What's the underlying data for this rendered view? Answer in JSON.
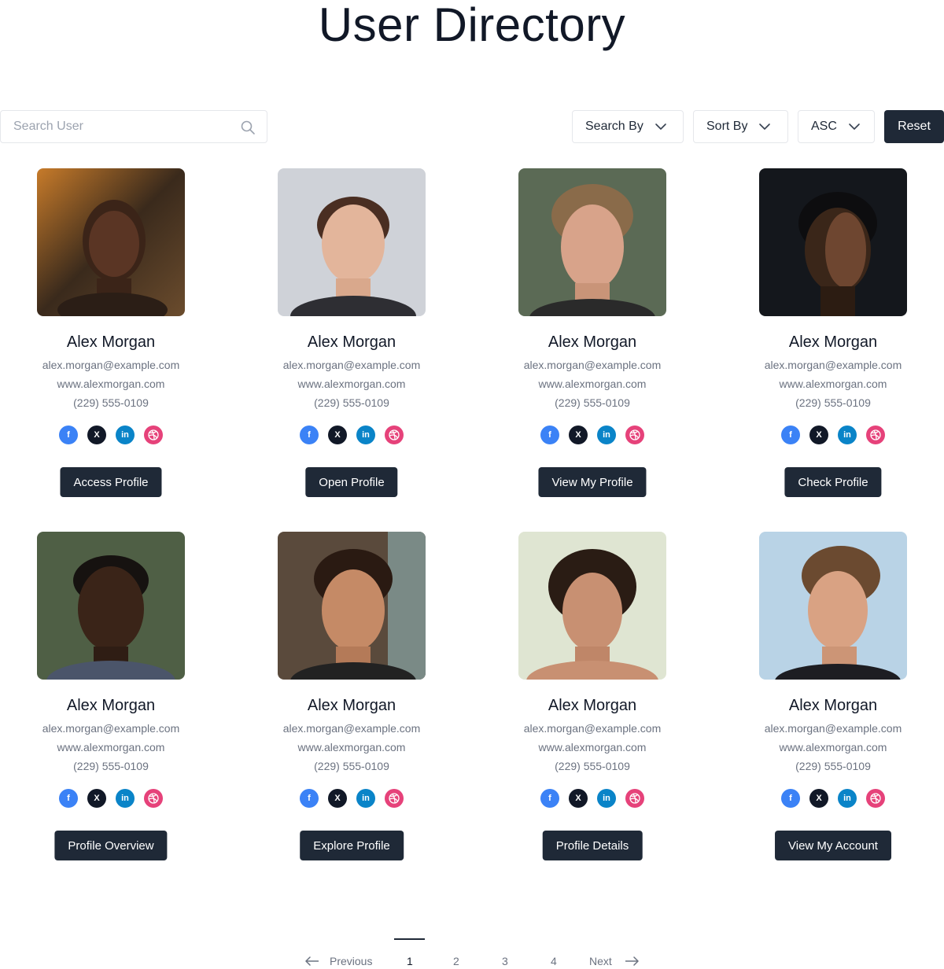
{
  "page": {
    "title": "User Directory"
  },
  "toolbar": {
    "search_placeholder": "Search User",
    "search_by_label": "Search By",
    "sort_by_label": "Sort By",
    "order_label": "ASC",
    "reset_label": "Reset"
  },
  "users": [
    {
      "name": "Alex Morgan",
      "email": "alex.morgan@example.com",
      "website": "www.alexmorgan.com",
      "phone": "(229) 555-0109",
      "button": "Access Profile"
    },
    {
      "name": "Alex Morgan",
      "email": "alex.morgan@example.com",
      "website": "www.alexmorgan.com",
      "phone": "(229) 555-0109",
      "button": "Open Profile"
    },
    {
      "name": "Alex Morgan",
      "email": "alex.morgan@example.com",
      "website": "www.alexmorgan.com",
      "phone": "(229) 555-0109",
      "button": "View My Profile"
    },
    {
      "name": "Alex Morgan",
      "email": "alex.morgan@example.com",
      "website": "www.alexmorgan.com",
      "phone": "(229) 555-0109",
      "button": "Check Profile"
    },
    {
      "name": "Alex Morgan",
      "email": "alex.morgan@example.com",
      "website": "www.alexmorgan.com",
      "phone": "(229) 555-0109",
      "button": "Profile Overview"
    },
    {
      "name": "Alex Morgan",
      "email": "alex.morgan@example.com",
      "website": "www.alexmorgan.com",
      "phone": "(229) 555-0109",
      "button": "Explore Profile"
    },
    {
      "name": "Alex Morgan",
      "email": "alex.morgan@example.com",
      "website": "www.alexmorgan.com",
      "phone": "(229) 555-0109",
      "button": "Profile Details"
    },
    {
      "name": "Alex Morgan",
      "email": "alex.morgan@example.com",
      "website": "www.alexmorgan.com",
      "phone": "(229) 555-0109",
      "button": "View My Account"
    }
  ],
  "social_icons": [
    "facebook-icon",
    "x-icon",
    "linkedin-icon",
    "dribbble-icon"
  ],
  "colors": {
    "primary": "#1f2937",
    "facebook": "#3b82f6",
    "x": "#111827",
    "linkedin": "#0a84c8",
    "dribbble": "#e6427a"
  },
  "pagination": {
    "previous_label": "Previous",
    "next_label": "Next",
    "pages": [
      "1",
      "2",
      "3",
      "4"
    ],
    "current": "1"
  }
}
